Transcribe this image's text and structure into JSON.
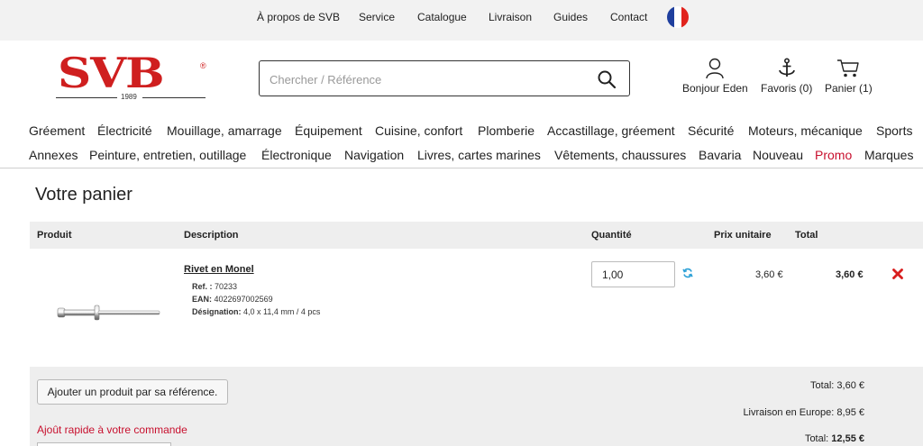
{
  "topbar": {
    "links": [
      "À propos de SVB",
      "Service",
      "Catalogue",
      "Livraison",
      "Guides",
      "Contact"
    ],
    "language_flag": [
      "#1f3f9e",
      "#ffffff",
      "#e1231d"
    ]
  },
  "logo": {
    "text": "SVB",
    "registered": "®",
    "year": "1989",
    "color": "#cf1f1f"
  },
  "search": {
    "placeholder": "Chercher / Référence",
    "value": ""
  },
  "account": {
    "user_label": "Bonjour Eden",
    "favorites_label": "Favoris (0)",
    "cart_label": "Panier (1)"
  },
  "nav": {
    "row1": [
      "Gréement",
      "Électricité",
      "Mouillage, amarrage",
      "Équipement",
      "Cuisine, confort",
      "Plomberie",
      "Accastillage, gréement",
      "Sécurité",
      "Moteurs, mécanique",
      "Sports"
    ],
    "row2": [
      "Annexes",
      "Peinture, entretien, outillage",
      "Électronique",
      "Navigation",
      "Livres, cartes marines",
      "Vêtements, chaussures",
      "Bavaria",
      "Nouveau",
      "Promo",
      "Marques"
    ],
    "promo_color": "#c8102e"
  },
  "cart": {
    "title": "Votre panier",
    "columns": {
      "product": "Produit",
      "description": "Description",
      "quantity": "Quantité",
      "unit_price": "Prix unitaire",
      "total": "Total"
    },
    "items": [
      {
        "name": "Rivet en Monel",
        "ref_label": "Ref. :",
        "ref": "70233",
        "ean_label": "EAN:",
        "ean": "4022697002569",
        "designation_label": "Désignation:",
        "designation": "4,0 x 11,4 mm / 4 pcs",
        "quantity": "1,00",
        "unit_price": "3,60 €",
        "total": "3,60 €"
      }
    ],
    "add_by_ref_label": "Ajouter un produit par sa référence.",
    "quick_add_label": "Ajoût rapide à votre commande",
    "summary": {
      "total_label": "Total:",
      "total_value": "3,60 €",
      "shipping_label": "Livraison en Europe:",
      "shipping_value": "8,95 €",
      "grand_total_label": "Total:",
      "grand_total_value": "12,55 €"
    }
  }
}
